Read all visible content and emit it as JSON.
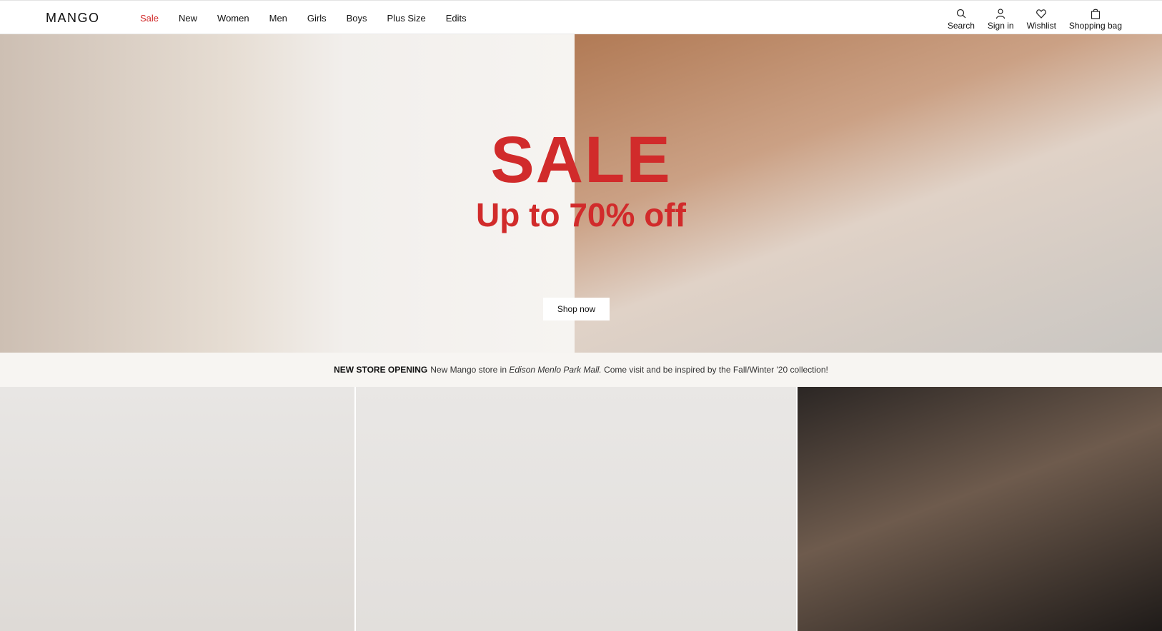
{
  "header": {
    "logo": "MANGO",
    "nav": [
      "Sale",
      "New",
      "Women",
      "Men",
      "Girls",
      "Boys",
      "Plus Size",
      "Edits"
    ],
    "utilities": [
      {
        "label": "Search",
        "icon": "search-icon"
      },
      {
        "label": "Sign in",
        "icon": "user-icon"
      },
      {
        "label": "Wishlist",
        "icon": "heart-icon"
      },
      {
        "label": "Shopping bag",
        "icon": "bag-icon"
      }
    ]
  },
  "hero": {
    "title": "SALE",
    "subtitle": "Up to 70% off",
    "cta": "Shop now"
  },
  "notice": {
    "label": "NEW STORE OPENING",
    "text_before": "New Mango store in",
    "place": "Edison Menlo Park Mall.",
    "text_after": "Come visit and be inspired by the Fall/Winter '20 collection!"
  },
  "colors": {
    "accent": "#d12b2b"
  }
}
